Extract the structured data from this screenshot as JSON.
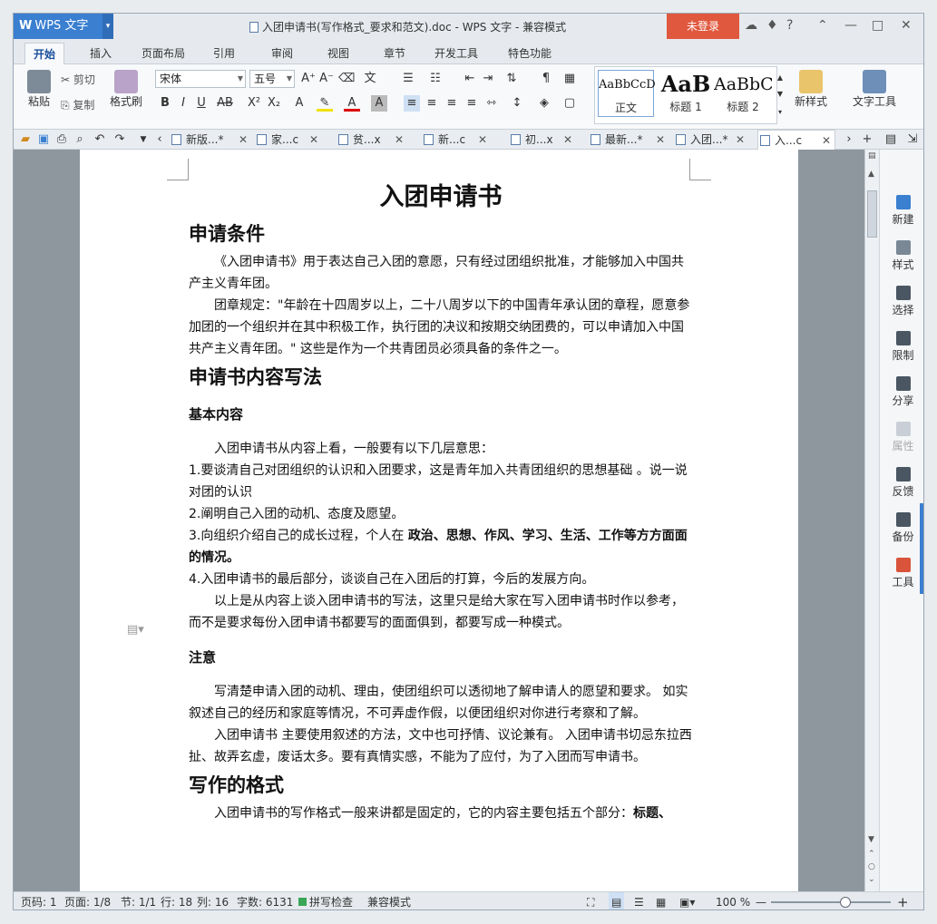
{
  "titlebar": {
    "app_label": "WPS 文字",
    "title": "入团申请书(写作格式_要求和范文).doc - WPS 文字 - 兼容模式",
    "login": "未登录",
    "help": "?"
  },
  "ribbon_tabs": [
    "开始",
    "插入",
    "页面布局",
    "引用",
    "审阅",
    "视图",
    "章节",
    "开发工具",
    "特色功能"
  ],
  "ribbon": {
    "paste": "粘贴",
    "cut": "剪切",
    "copy": "复制",
    "format_painter": "格式刷",
    "font_name": "宋体",
    "font_size": "五号",
    "styles": [
      {
        "preview": "AaBbCcD",
        "label": "正文"
      },
      {
        "preview": "AaB",
        "label": "标题 1"
      },
      {
        "preview": "AaBbC",
        "label": "标题 2"
      }
    ],
    "new_style": "新样式",
    "text_tools": "文字工具"
  },
  "doc_tabs": [
    {
      "label": "新版...*"
    },
    {
      "label": "家...c"
    },
    {
      "label": "贫...x"
    },
    {
      "label": "新...c"
    },
    {
      "label": "初...x"
    },
    {
      "label": "最新...*"
    },
    {
      "label": "入团...*"
    },
    {
      "label": "入...c"
    }
  ],
  "document": {
    "title": "入团申请书",
    "h_conditions": "申请条件",
    "p1": "《入团申请书》用于表达自己入团的意愿，只有经过团组织批准，才能够加入中国共产主义青年团。",
    "p2": "团章规定：\"年龄在十四周岁以上，二十八周岁以下的中国青年承认团的章程，愿意参加团的一个组织并在其中积极工作，执行团的决议和按期交纳团费的，可以申请加入中国共产主义青年团。\" 这些是作为一个共青团员必须具备的条件之一。",
    "h_writing": "申请书内容写法",
    "h_basic": "基本内容",
    "p3": "入团申请书从内容上看，一般要有以下几层意思：",
    "item1": "1.要谈清自己对团组织的认识和入团要求，这是青年加入共青团组织的思想基础  。说一说对团的认识",
    "item2": "2.阐明自己入团的动机、态度及愿望。",
    "item3_a": "3.向组织介绍自己的成长过程，个人在 ",
    "item3_b": "政治、思想、作风、学习、生活、工作等方方面面的情况。",
    "item4": "4.入团申请书的最后部分，谈谈自己在入团后的打算，今后的发展方向。",
    "p4": "以上是从内容上谈入团申请书的写法，这里只是给大家在写入团申请书时作以参考，而不是要求每份入团申请书都要写的面面俱到，都要写成一种模式。",
    "h_note": "注意",
    "p5": "写清楚申请入团的动机、理由，使团组织可以透彻地了解申请人的愿望和要求。 如实叙述自己的经历和家庭等情况，不可弄虚作假，以便团组织对你进行考察和了解。",
    "p6": "入团申请书 主要使用叙述的方法，文中也可抒情、议论兼有。 入团申请书切忌东拉西扯、故弄玄虚，废话太多。要有真情实感，不能为了应付，为了入团而写申请书。",
    "h_format": "写作的格式",
    "p7_a": "入团申请书的写作格式一般来讲都是固定的，它的内容主要包括五个部分：",
    "p7_b": "标题、"
  },
  "right_panel": [
    "新建",
    "样式",
    "选择",
    "限制",
    "分享",
    "属性",
    "反馈",
    "备份",
    "工具"
  ],
  "status": {
    "page": "页码: 1",
    "pages": "页面: 1/8",
    "section": "节: 1/1",
    "row": "行: 18",
    "col": "列: 16",
    "words": "字数: 6131",
    "spell": "拼写检查",
    "compat": "兼容模式",
    "zoom": "100 %",
    "zoom_level": 0.62
  }
}
